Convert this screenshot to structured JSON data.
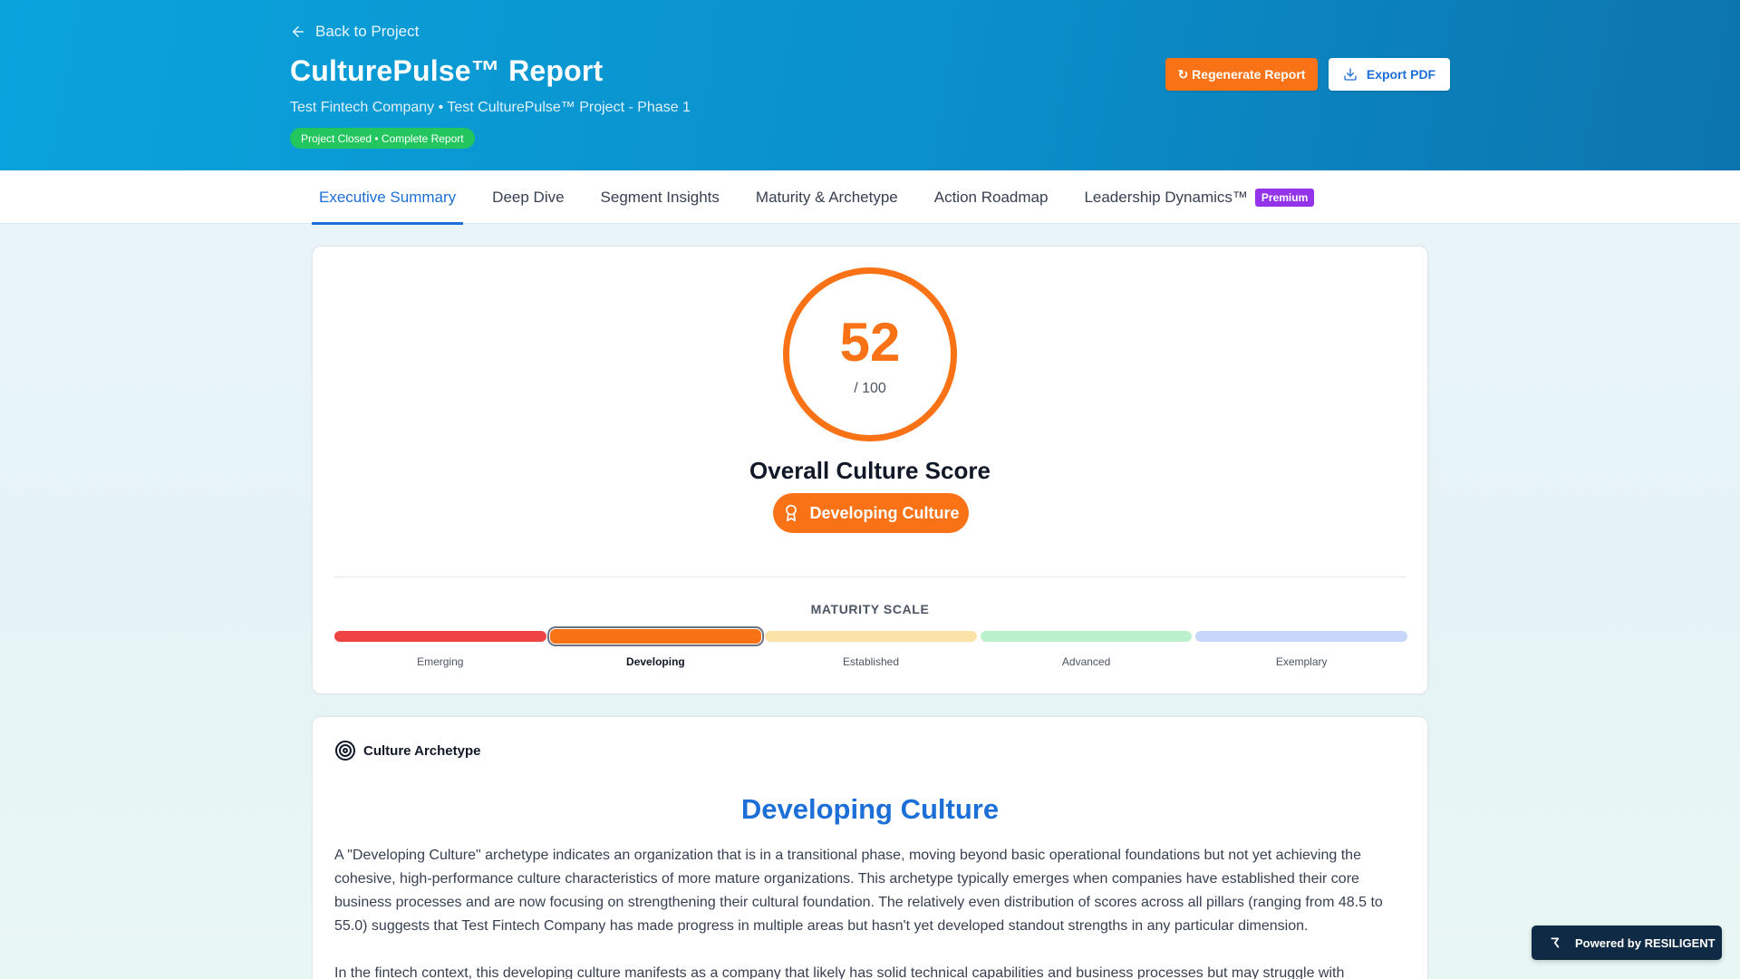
{
  "header": {
    "back_label": "Back to Project",
    "title": "CulturePulse™ Report",
    "subtitle": "Test Fintech Company • Test CulturePulse™ Project - Phase 1",
    "status_badge": "Project Closed • Complete Report",
    "regenerate_label": "↻ Regenerate Report",
    "export_label": "Export PDF"
  },
  "tabs": [
    {
      "label": "Executive Summary",
      "active": true
    },
    {
      "label": "Deep Dive",
      "active": false
    },
    {
      "label": "Segment Insights",
      "active": false
    },
    {
      "label": "Maturity & Archetype",
      "active": false
    },
    {
      "label": "Action Roadmap",
      "active": false
    },
    {
      "label": "Leadership Dynamics™",
      "active": false,
      "badge": "Premium"
    }
  ],
  "score": {
    "value": "52",
    "max": "/ 100",
    "label": "Overall Culture Score",
    "archetype": "Developing Culture"
  },
  "maturity_scale": {
    "title": "MATURITY SCALE",
    "current": "Developing",
    "levels": [
      {
        "label": "Emerging",
        "color": "#ef4444"
      },
      {
        "label": "Developing",
        "color": "#f97316"
      },
      {
        "label": "Established",
        "color": "#fbe3a7"
      },
      {
        "label": "Advanced",
        "color": "#bbf0cc"
      },
      {
        "label": "Exemplary",
        "color": "#c7d7fb"
      }
    ]
  },
  "archetype_section": {
    "heading": "Culture Archetype",
    "title": "Developing Culture",
    "paragraph_1": "A \"Developing Culture\" archetype indicates an organization that is in a transitional phase, moving beyond basic operational foundations but not yet achieving the cohesive, high-performance culture characteristics of more mature organizations. This archetype typically emerges when companies have established their core business processes and are now focusing on strengthening their cultural foundation. The relatively even distribution of scores across all pillars (ranging from 48.5 to 55.0) suggests that Test Fintech Company has made progress in multiple areas but hasn't yet developed standout strengths in any particular dimension.",
    "paragraph_2": "In the fintech context, this developing culture manifests as a company that likely has solid technical capabilities and business processes but may struggle with"
  },
  "powered_by": "Powered by RESILIGENT",
  "colors": {
    "accent": "#1d6fd8",
    "score_orange": "#f97316",
    "status_green": "#22c55e",
    "premium_purple": "#9333ea",
    "header_blue": "#0a8fcb"
  }
}
